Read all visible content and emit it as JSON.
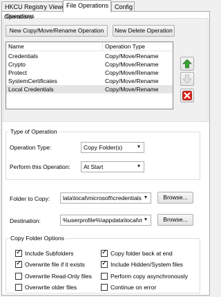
{
  "tabs": [
    {
      "label": "HKCU Registry Viewer",
      "active": false
    },
    {
      "label": "File Operations",
      "active": true
    },
    {
      "label": "Config",
      "active": false
    }
  ],
  "operations": {
    "title": "Operations",
    "new_copy_button": "New Copy/Move/Rename Operation",
    "new_delete_button": "New Delete Operation",
    "columns": [
      "Name",
      "Operation Type"
    ],
    "rows": [
      {
        "name": "Credentials",
        "type": "Copy/Move/Rename",
        "selected": false
      },
      {
        "name": "Crypto",
        "type": "Copy/Move/Rename",
        "selected": false
      },
      {
        "name": "Protect",
        "type": "Copy/Move/Rename",
        "selected": false
      },
      {
        "name": "SystemCertificates",
        "type": "Copy/Move/Rename",
        "selected": false
      },
      {
        "name": "Local Credentials",
        "type": "Copy/Move/Rename",
        "selected": true
      }
    ]
  },
  "type_of_operation": {
    "title": "Type of Operation",
    "operation_type_label": "Operation Type:",
    "operation_type_value": "Copy Folder(s)",
    "perform_label": "Perform this Operation:",
    "perform_value": "At Start"
  },
  "folder_to_copy": {
    "label": "Folder to Copy:",
    "value": "lata\\local\\microsoft\\credentials",
    "browse": "Browse..."
  },
  "destination": {
    "label": "Destination:",
    "value": "%userprofile%\\appdata\\local\\m",
    "browse": "Browse..."
  },
  "copy_options": {
    "title": "Copy Folder Options",
    "options": [
      {
        "label": "Include Subfolders",
        "checked": true
      },
      {
        "label": "Copy folder back at end",
        "checked": true
      },
      {
        "label": "Overwrite file if it exists",
        "checked": true
      },
      {
        "label": "Include Hidden/System files",
        "checked": true
      },
      {
        "label": "Overwrite Read-Only files",
        "checked": false
      },
      {
        "label": "Perform copy asynchronously",
        "checked": false
      },
      {
        "label": "Overwrite older files",
        "checked": false
      },
      {
        "label": "Continue on error",
        "checked": false
      }
    ]
  },
  "icons": {
    "move_up": "arrow-up-icon",
    "move_down": "arrow-down-icon",
    "delete": "delete-x-icon",
    "dropdown": "chevron-down-icon"
  },
  "colors": {
    "up_arrow": "#3aa336",
    "down_arrow": "#c8c8c8",
    "delete": "#d9231b"
  }
}
